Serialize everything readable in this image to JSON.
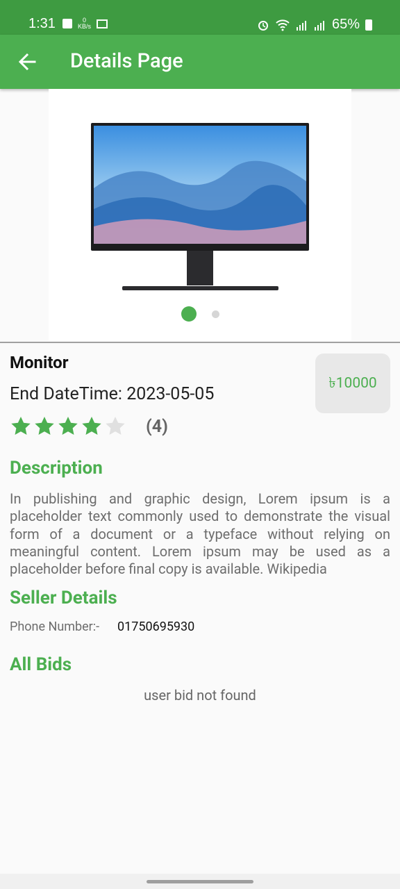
{
  "status_bar": {
    "time": "1:31",
    "kb_top": "0",
    "kb_bottom": "KB/s",
    "battery": "65%"
  },
  "app_bar": {
    "title": "Details Page",
    "back_icon": "arrow-left-icon"
  },
  "carousel": {
    "image": "monitor-image",
    "page_count": 2,
    "active_index": 0
  },
  "product": {
    "name": "Monitor",
    "end_datetime": "End DateTime: 2023-05-05",
    "price": "৳10000",
    "rating": 4,
    "rating_max": 5,
    "rating_count": "(4)"
  },
  "description": {
    "title": "Description",
    "text": "In publishing and graphic design, Lorem ipsum is a placeholder text commonly used to demonstrate the visual form of a document or a typeface without relying on meaningful content. Lorem ipsum may be used as a placeholder before final copy is available. Wikipedia"
  },
  "seller": {
    "title": "Seller Details",
    "phone_label": "Phone Number:-",
    "phone_value": "01750695930"
  },
  "bids": {
    "title": "All Bids",
    "empty_text": "user bid not found"
  },
  "colors": {
    "primary": "#4caf50",
    "status_bar": "#3e9b41",
    "star_empty": "#e0e0e0"
  }
}
